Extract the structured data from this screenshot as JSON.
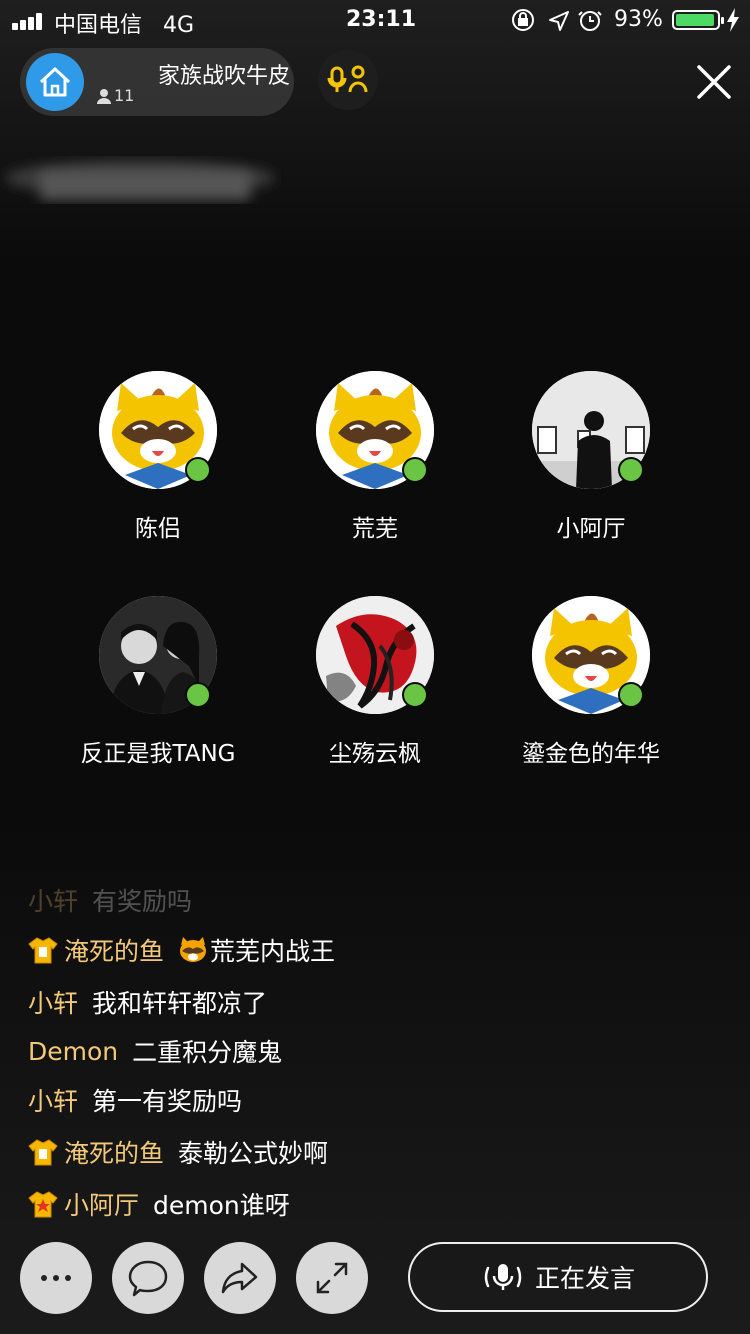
{
  "status_bar": {
    "carrier": "中国电信",
    "network": "4G",
    "time": "23:11",
    "battery": "93%",
    "battery_level": 0.93,
    "icons": [
      "lock-rotation-icon",
      "location-icon",
      "alarm-icon"
    ]
  },
  "room": {
    "title": "家族战吹牛皮",
    "member_count": "11",
    "logo_icon": "home-icon",
    "logo_color": "#2e9ae8"
  },
  "seats": [
    {
      "name": "陈侣",
      "avatar": "raccoon-mascot"
    },
    {
      "name": "荒芜",
      "avatar": "raccoon-mascot"
    },
    {
      "name": "小阿厅",
      "avatar": "gallery-silhouette-photo"
    },
    {
      "name": "反正是我TANG",
      "avatar": "couple-photo"
    },
    {
      "name": "尘殇云枫",
      "avatar": "red-ink-art"
    },
    {
      "name": "鎏金色的年华",
      "avatar": "raccoon-mascot"
    }
  ],
  "chat": [
    {
      "nick": "小轩",
      "msg": "有奖励吗",
      "badge": ""
    },
    {
      "nick": "淹死的鱼",
      "msg": "荒芜内战王",
      "badge": "gold-shirt-badge",
      "msg_icon": "raccoon-emoji"
    },
    {
      "nick": "小轩",
      "msg": "我和轩轩都凉了",
      "badge": ""
    },
    {
      "nick": "Demon",
      "msg": "二重积分魔鬼",
      "badge": ""
    },
    {
      "nick": "小轩",
      "msg": "第一有奖励吗",
      "badge": ""
    },
    {
      "nick": "淹死的鱼",
      "msg": "泰勒公式妙啊",
      "badge": "gold-shirt-badge"
    },
    {
      "nick": "小阿厅",
      "msg": "demon谁呀",
      "badge": "gold-star-badge"
    }
  ],
  "bottom_bar": {
    "speak_label": "正在发言",
    "buttons": [
      "more-icon",
      "chat-bubble-icon",
      "share-icon",
      "expand-icon"
    ]
  },
  "colors": {
    "nick": "#f3c879",
    "online": "#6ac544",
    "accent": "#f5c400"
  }
}
